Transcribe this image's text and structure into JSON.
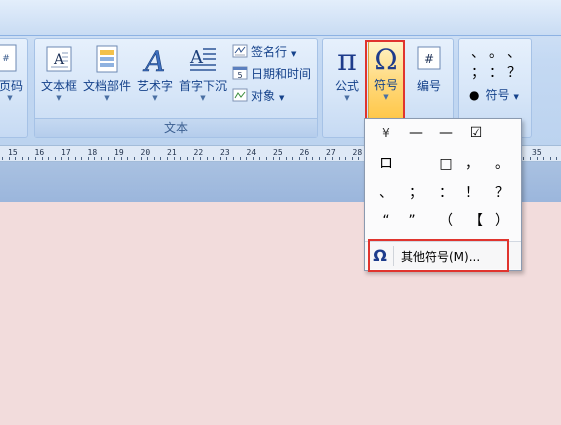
{
  "ribbon": {
    "left_partial": {
      "label": "页码"
    },
    "text_group": {
      "caption": "文本",
      "buttons": [
        {
          "label": "文本框"
        },
        {
          "label": "文档部件"
        },
        {
          "label": "艺术字"
        },
        {
          "label": "首字下沉"
        }
      ],
      "small": [
        {
          "label": "签名行",
          "icon": "signature-line-icon"
        },
        {
          "label": "日期和时间",
          "icon": "date-time-icon"
        },
        {
          "label": "对象",
          "icon": "object-icon"
        }
      ]
    },
    "symbols_group": {
      "formula_label": "公式",
      "symbol_label": "符号",
      "number_label": "编号"
    },
    "special_group": {
      "symbol_label": "符号",
      "marks": [
        "、",
        "。",
        "、",
        "；",
        "：",
        "？"
      ]
    }
  },
  "ruler": {
    "numbers": [
      "15",
      "16",
      "17",
      "18",
      "19",
      "20",
      "21",
      "22",
      "23",
      "24",
      "25",
      "26",
      "27",
      "28",
      "35"
    ]
  },
  "dropdown": {
    "symbols": [
      [
        "¥",
        "—",
        "—",
        "☑"
      ],
      [
        "ロ",
        "",
        "□",
        "，",
        "。"
      ],
      [
        "、",
        "；",
        "：",
        "！",
        "？"
      ],
      [
        "“",
        "”",
        "（",
        "【",
        "）"
      ]
    ],
    "more_label": "其他符号(M)..."
  },
  "colors": {
    "accent_red": "#e0342e",
    "ribbon_blue": "#c4d9f3",
    "document_bg": "#f2dcdc"
  }
}
